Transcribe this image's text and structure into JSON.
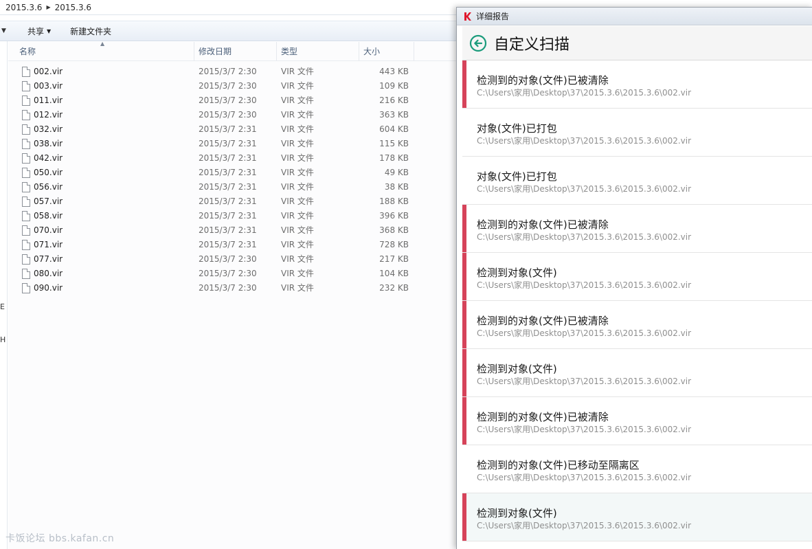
{
  "explorer": {
    "breadcrumb": [
      "2015.3.6",
      "2015.3.6"
    ],
    "toolbar": {
      "share_label": "共享",
      "new_folder_label": "新建文件夹"
    },
    "nav_fragments": [
      "E",
      "H"
    ],
    "columns": {
      "name": "名称",
      "date": "修改日期",
      "type": "类型",
      "size": "大小"
    },
    "files": [
      {
        "name": "002.vir",
        "date": "2015/3/7 2:30",
        "type": "VIR 文件",
        "size": "443 KB"
      },
      {
        "name": "003.vir",
        "date": "2015/3/7 2:30",
        "type": "VIR 文件",
        "size": "109 KB"
      },
      {
        "name": "011.vir",
        "date": "2015/3/7 2:30",
        "type": "VIR 文件",
        "size": "216 KB"
      },
      {
        "name": "012.vir",
        "date": "2015/3/7 2:30",
        "type": "VIR 文件",
        "size": "363 KB"
      },
      {
        "name": "032.vir",
        "date": "2015/3/7 2:31",
        "type": "VIR 文件",
        "size": "604 KB"
      },
      {
        "name": "038.vir",
        "date": "2015/3/7 2:31",
        "type": "VIR 文件",
        "size": "115 KB"
      },
      {
        "name": "042.vir",
        "date": "2015/3/7 2:31",
        "type": "VIR 文件",
        "size": "178 KB"
      },
      {
        "name": "050.vir",
        "date": "2015/3/7 2:31",
        "type": "VIR 文件",
        "size": "49 KB"
      },
      {
        "name": "056.vir",
        "date": "2015/3/7 2:31",
        "type": "VIR 文件",
        "size": "38 KB"
      },
      {
        "name": "057.vir",
        "date": "2015/3/7 2:31",
        "type": "VIR 文件",
        "size": "188 KB"
      },
      {
        "name": "058.vir",
        "date": "2015/3/7 2:31",
        "type": "VIR 文件",
        "size": "396 KB"
      },
      {
        "name": "070.vir",
        "date": "2015/3/7 2:31",
        "type": "VIR 文件",
        "size": "368 KB"
      },
      {
        "name": "071.vir",
        "date": "2015/3/7 2:31",
        "type": "VIR 文件",
        "size": "728 KB"
      },
      {
        "name": "077.vir",
        "date": "2015/3/7 2:30",
        "type": "VIR 文件",
        "size": "217 KB"
      },
      {
        "name": "080.vir",
        "date": "2015/3/7 2:30",
        "type": "VIR 文件",
        "size": "104 KB"
      },
      {
        "name": "090.vir",
        "date": "2015/3/7 2:30",
        "type": "VIR 文件",
        "size": "232 KB"
      }
    ]
  },
  "report": {
    "window_title": "详细报告",
    "header_title": "自定义扫描",
    "accent_color": "#1a9b7b",
    "alert_color": "#d6435a",
    "items": [
      {
        "title": "检测到的对象(文件)已被清除",
        "path": "C:\\Users\\家用\\Desktop\\37\\2015.3.6\\2015.3.6\\002.vir",
        "alert": true,
        "selected": false
      },
      {
        "title": "对象(文件)已打包",
        "path": "C:\\Users\\家用\\Desktop\\37\\2015.3.6\\2015.3.6\\002.vir",
        "alert": false,
        "selected": false
      },
      {
        "title": "对象(文件)已打包",
        "path": "C:\\Users\\家用\\Desktop\\37\\2015.3.6\\2015.3.6\\002.vir",
        "alert": false,
        "selected": false
      },
      {
        "title": "检测到的对象(文件)已被清除",
        "path": "C:\\Users\\家用\\Desktop\\37\\2015.3.6\\2015.3.6\\002.vir",
        "alert": true,
        "selected": false
      },
      {
        "title": "检测到对象(文件)",
        "path": "C:\\Users\\家用\\Desktop\\37\\2015.3.6\\2015.3.6\\002.vir",
        "alert": true,
        "selected": false
      },
      {
        "title": "检测到的对象(文件)已被清除",
        "path": "C:\\Users\\家用\\Desktop\\37\\2015.3.6\\2015.3.6\\002.vir",
        "alert": true,
        "selected": false
      },
      {
        "title": "检测到对象(文件)",
        "path": "C:\\Users\\家用\\Desktop\\37\\2015.3.6\\2015.3.6\\002.vir",
        "alert": true,
        "selected": false
      },
      {
        "title": "检测到的对象(文件)已被清除",
        "path": "C:\\Users\\家用\\Desktop\\37\\2015.3.6\\2015.3.6\\002.vir",
        "alert": true,
        "selected": false
      },
      {
        "title": "检测到的对象(文件)已移动至隔离区",
        "path": "C:\\Users\\家用\\Desktop\\37\\2015.3.6\\2015.3.6\\002.vir",
        "alert": false,
        "selected": false
      },
      {
        "title": "检测到对象(文件)",
        "path": "C:\\Users\\家用\\Desktop\\37\\2015.3.6\\2015.3.6\\002.vir",
        "alert": true,
        "selected": true
      }
    ]
  },
  "watermark": "卡饭论坛 bbs.kafan.cn"
}
